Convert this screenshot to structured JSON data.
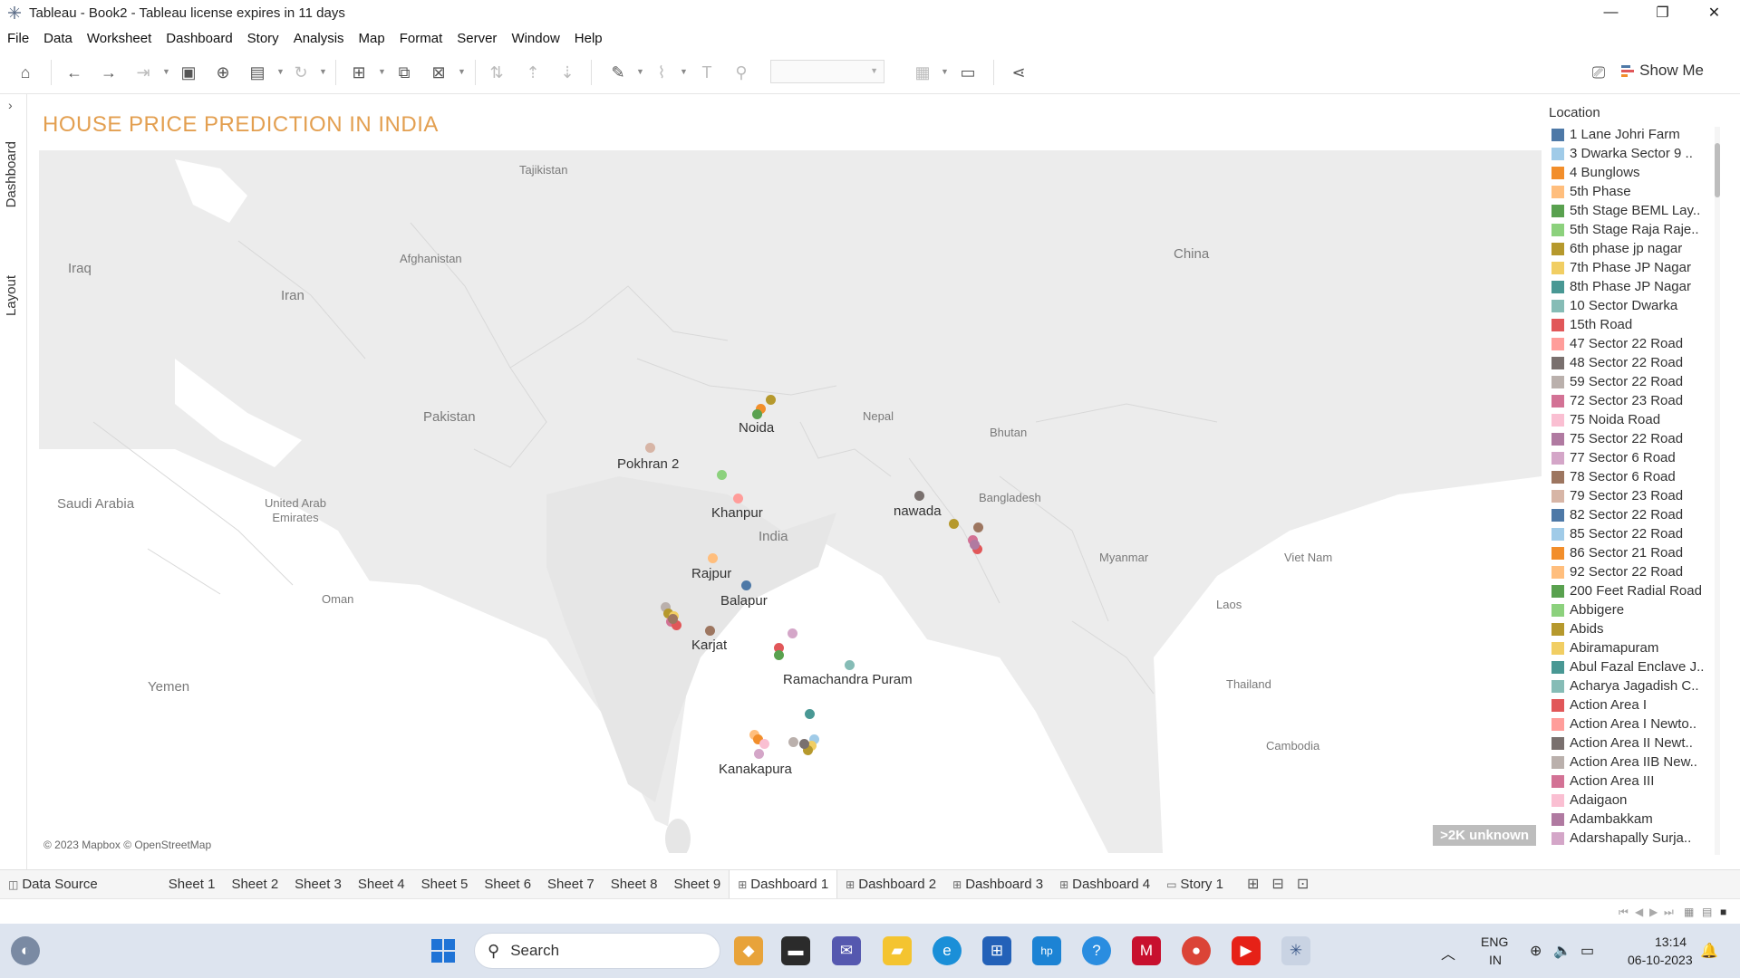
{
  "window": {
    "title": "Tableau - Book2 - Tableau license expires in 11 days",
    "minimize_glyph": "—",
    "restore_glyph": "❐",
    "close_glyph": "✕"
  },
  "menu": [
    "File",
    "Data",
    "Worksheet",
    "Dashboard",
    "Story",
    "Analysis",
    "Map",
    "Format",
    "Server",
    "Window",
    "Help"
  ],
  "toolbar": {
    "show_me_label": "Show Me",
    "icons": [
      "home-icon",
      "undo-icon",
      "redo-icon",
      "replay-icon",
      "save-icon",
      "new-data-source-icon",
      "pause-updates-icon",
      "refresh-icon",
      "new-worksheet-icon",
      "duplicate-icon",
      "clear-icon",
      "swap-icon",
      "sort-ascending-icon",
      "sort-descending-icon",
      "highlight-icon",
      "group-icon",
      "labels-icon",
      "pin-icon",
      "fit-dropdown",
      "show-cards-icon",
      "presentation-icon",
      "share-icon",
      "pin-tooltip-icon"
    ]
  },
  "side_tabs": {
    "dashboard": "Dashboard",
    "layout": "Layout"
  },
  "dashboard": {
    "title": "HOUSE PRICE PREDICTION IN INDIA",
    "attribution": "© 2023 Mapbox © OpenStreetMap",
    "unknown_badge": ">2K unknown",
    "countries": [
      {
        "name": "Tajikistan",
        "size": "sm"
      },
      {
        "name": "Afghanistan",
        "size": "sm"
      },
      {
        "name": "Iraq",
        "size": "lg"
      },
      {
        "name": "Iran",
        "size": "lg"
      },
      {
        "name": "Pakistan",
        "size": "lg"
      },
      {
        "name": "China",
        "size": "lg"
      },
      {
        "name": "Nepal",
        "size": "sm"
      },
      {
        "name": "Bhutan",
        "size": "sm"
      },
      {
        "name": "Saudi Arabia",
        "size": "lg"
      },
      {
        "name": "United Arab Emirates",
        "size": "sm"
      },
      {
        "name": "India",
        "size": "lg"
      },
      {
        "name": "Bangladesh",
        "size": "sm"
      },
      {
        "name": "Myanmar",
        "size": "sm"
      },
      {
        "name": "Viet Nam",
        "size": "sm"
      },
      {
        "name": "Laos",
        "size": "sm"
      },
      {
        "name": "Oman",
        "size": "sm"
      },
      {
        "name": "Yemen",
        "size": "lg"
      },
      {
        "name": "Thailand",
        "size": "sm"
      },
      {
        "name": "Cambodia",
        "size": "sm"
      }
    ],
    "places": [
      "Noida",
      "Pokhran 2",
      "Khanpur",
      "nawada",
      "Rajpur",
      "Balapur",
      "Karjat",
      "Ramachandra Puram",
      "Kanakapura"
    ]
  },
  "legend": {
    "title": "Location",
    "items": [
      {
        "label": "1 Lane Johri Farm",
        "color": "#4E79A7"
      },
      {
        "label": "3 Dwarka Sector 9 ..",
        "color": "#A0CBE8"
      },
      {
        "label": "4 Bunglows",
        "color": "#F28E2B"
      },
      {
        "label": "5th Phase",
        "color": "#FFBE7D"
      },
      {
        "label": "5th Stage BEML Lay..",
        "color": "#59A14F"
      },
      {
        "label": "5th Stage Raja Raje..",
        "color": "#8CD17D"
      },
      {
        "label": "6th phase jp nagar",
        "color": "#B6992D"
      },
      {
        "label": "7th Phase JP Nagar",
        "color": "#F1CE63"
      },
      {
        "label": "8th Phase JP Nagar",
        "color": "#499894"
      },
      {
        "label": "10 Sector Dwarka",
        "color": "#86BCB6"
      },
      {
        "label": "15th Road",
        "color": "#E15759"
      },
      {
        "label": "47 Sector 22 Road",
        "color": "#FF9D9A"
      },
      {
        "label": "48 Sector 22 Road",
        "color": "#79706E"
      },
      {
        "label": "59 Sector 22 Road",
        "color": "#BAB0AC"
      },
      {
        "label": "72 Sector 23 Road",
        "color": "#D37295"
      },
      {
        "label": "75 Noida Road",
        "color": "#FABFD2"
      },
      {
        "label": "75 Sector 22 Road",
        "color": "#B07AA1"
      },
      {
        "label": "77 Sector 6 Road",
        "color": "#D4A6C8"
      },
      {
        "label": "78 Sector 6 Road",
        "color": "#9D7660"
      },
      {
        "label": "79 Sector 23 Road",
        "color": "#D7B5A6"
      },
      {
        "label": "82 Sector 22 Road",
        "color": "#4E79A7"
      },
      {
        "label": "85 Sector 22 Road",
        "color": "#A0CBE8"
      },
      {
        "label": "86 Sector 21 Road",
        "color": "#F28E2B"
      },
      {
        "label": "92 Sector 22 Road",
        "color": "#FFBE7D"
      },
      {
        "label": "200 Feet Radial Road",
        "color": "#59A14F"
      },
      {
        "label": "Abbigere",
        "color": "#8CD17D"
      },
      {
        "label": "Abids",
        "color": "#B6992D"
      },
      {
        "label": "Abiramapuram",
        "color": "#F1CE63"
      },
      {
        "label": "Abul Fazal Enclave J..",
        "color": "#499894"
      },
      {
        "label": "Acharya Jagadish C..",
        "color": "#86BCB6"
      },
      {
        "label": "Action Area I",
        "color": "#E15759"
      },
      {
        "label": "Action Area I Newto..",
        "color": "#FF9D9A"
      },
      {
        "label": "Action Area II Newt..",
        "color": "#79706E"
      },
      {
        "label": "Action Area IIB New..",
        "color": "#BAB0AC"
      },
      {
        "label": "Action Area III",
        "color": "#D37295"
      },
      {
        "label": "Adaigaon",
        "color": "#FABFD2"
      },
      {
        "label": "Adambakkam",
        "color": "#B07AA1"
      },
      {
        "label": "Adarshapally Surja..",
        "color": "#D4A6C8"
      }
    ]
  },
  "sheet_tabs": [
    {
      "label": "Data Source",
      "icon": "◫",
      "active": false
    },
    {
      "label": "Sheet 1",
      "icon": "",
      "active": false
    },
    {
      "label": "Sheet 2",
      "icon": "",
      "active": false
    },
    {
      "label": "Sheet 3",
      "icon": "",
      "active": false
    },
    {
      "label": "Sheet 4",
      "icon": "",
      "active": false
    },
    {
      "label": "Sheet 5",
      "icon": "",
      "active": false
    },
    {
      "label": "Sheet 6",
      "icon": "",
      "active": false
    },
    {
      "label": "Sheet 7",
      "icon": "",
      "active": false
    },
    {
      "label": "Sheet 8",
      "icon": "",
      "active": false
    },
    {
      "label": "Sheet 9",
      "icon": "",
      "active": false
    },
    {
      "label": "Dashboard 1",
      "icon": "⊞",
      "active": true
    },
    {
      "label": "Dashboard 2",
      "icon": "⊞",
      "active": false
    },
    {
      "label": "Dashboard 3",
      "icon": "⊞",
      "active": false
    },
    {
      "label": "Dashboard 4",
      "icon": "⊞",
      "active": false
    },
    {
      "label": "Story 1",
      "icon": "▭",
      "active": false
    }
  ],
  "taskbar": {
    "search_placeholder": "Search",
    "lang": "ENG",
    "region": "IN",
    "time": "13:14",
    "date": "06-10-2023",
    "apps": [
      "copilot-icon",
      "windows-start-icon",
      "search-icon",
      "store-icon",
      "file-manager-icon",
      "teams-icon",
      "file-explorer-icon",
      "edge-icon",
      "ms-store-icon",
      "myhp-icon",
      "tips-icon",
      "mcafee-icon",
      "chrome-icon",
      "youtube-icon",
      "tableau-icon"
    ]
  }
}
